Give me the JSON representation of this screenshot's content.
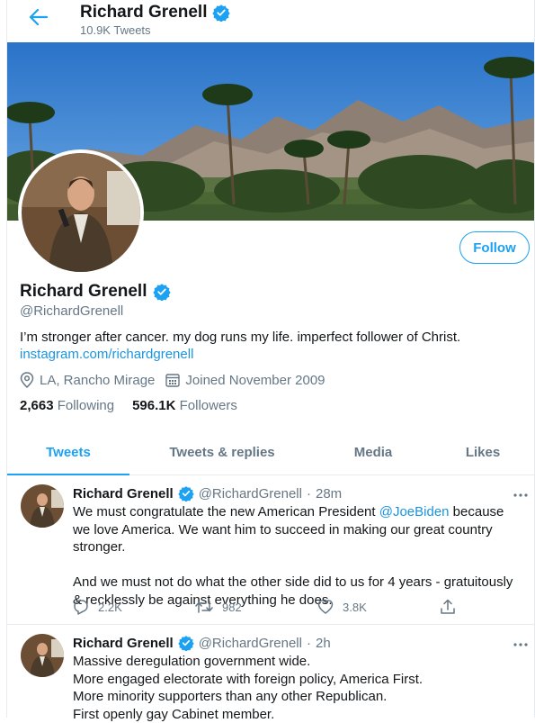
{
  "header": {
    "title": "Richard Grenell",
    "tweet_count": "10.9K Tweets"
  },
  "profile": {
    "name": "Richard Grenell",
    "handle": "@RichardGrenell",
    "bio": "I’m stronger after cancer. my dog runs my life. imperfect follower of Christ.",
    "link": "instagram.com/richardgrenell",
    "location": "LA, Rancho Mirage",
    "joined": "Joined November 2009",
    "following_count": "2,663",
    "following_label": "Following",
    "followers_count": "596.1K",
    "followers_label": "Followers",
    "follow_button": "Follow"
  },
  "tabs": [
    {
      "label": "Tweets",
      "active": true
    },
    {
      "label": "Tweets & replies",
      "active": false
    },
    {
      "label": "Media",
      "active": false
    },
    {
      "label": "Likes",
      "active": false
    }
  ],
  "tweets": [
    {
      "name": "Richard Grenell",
      "handle": "@RichardGrenell",
      "sep": "·",
      "time": "28m",
      "line1a": "We must congratulate the new American President ",
      "mention": "@JoeBiden",
      "line1b": " because we love America. We want him to succeed in making our great country stronger.",
      "para2": "And we must not do what the other side did to us for 4 years - gratuitously & recklessly be against everything he does.",
      "replies": "2.2K",
      "retweets": "982",
      "likes": "3.8K"
    },
    {
      "name": "Richard Grenell",
      "handle": "@RichardGrenell",
      "sep": "·",
      "time": "2h",
      "lines": [
        "Massive deregulation government wide.",
        "More engaged electorate with foreign policy, America First.",
        "More minority supporters than any other Republican.",
        "First openly gay Cabinet member."
      ]
    }
  ],
  "colors": {
    "accent": "#1da1f2",
    "link": "#1b95e0",
    "muted": "#657786",
    "text": "#14171a",
    "border": "#e6ecf0"
  },
  "icons": [
    "back-arrow-icon",
    "verified-badge-icon",
    "location-icon",
    "calendar-icon",
    "more-icon",
    "reply-icon",
    "retweet-icon",
    "like-icon",
    "share-icon"
  ]
}
